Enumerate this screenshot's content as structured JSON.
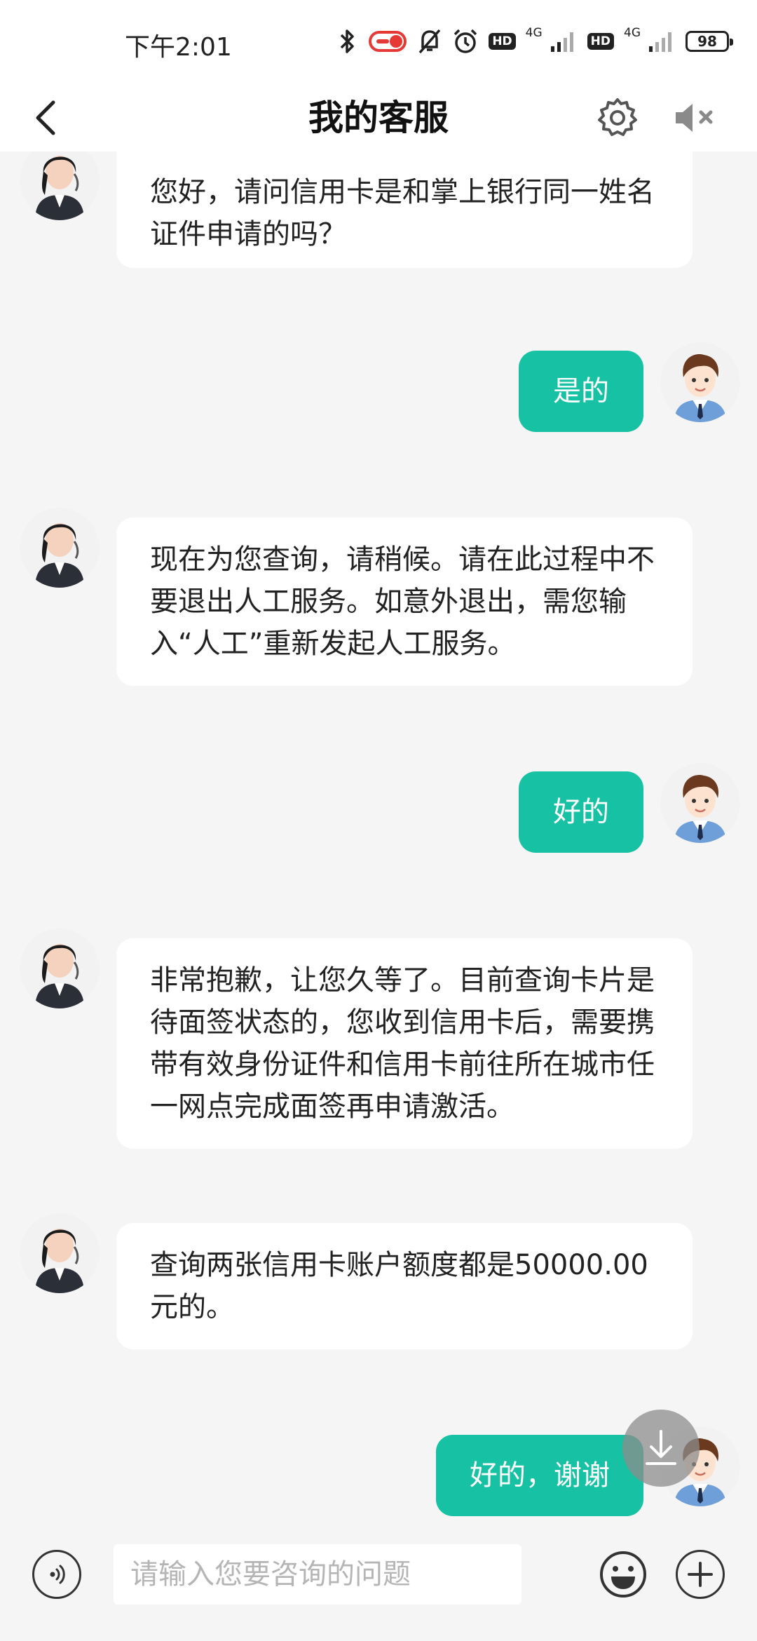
{
  "status_bar": {
    "time": "下午2:01",
    "hd1": "HD",
    "net1": "4G",
    "hd2": "HD",
    "net2": "4G",
    "battery": "98",
    "icons": [
      "bluetooth-icon",
      "recording-pill-icon",
      "bell-muted-icon",
      "alarm-icon",
      "signal-icon",
      "battery-icon"
    ]
  },
  "header": {
    "title": "我的客服",
    "back_icon": "chevron-left-icon",
    "settings_icon": "gear-icon",
    "mute_icon": "speaker-muted-icon"
  },
  "colors": {
    "accent": "#16c2a3",
    "background": "#f5f5f5",
    "agent_bubble": "#ffffff"
  },
  "messages": [
    {
      "from": "agent",
      "text": "您好，请问信用卡是和掌上银行同一姓名证件申请的吗？"
    },
    {
      "from": "user",
      "text": "是的"
    },
    {
      "from": "agent",
      "text": "现在为您查询，请稍候。请在此过程中不要退出人工服务。如意外退出，需您输入“人工”重新发起人工服务。"
    },
    {
      "from": "user",
      "text": "好的"
    },
    {
      "from": "agent",
      "text": "非常抱歉，让您久等了。目前查询卡片是待面签状态的，您收到信用卡后，需要携带有效身份证件和信用卡前往所在城市任一网点完成面签再申请激活。"
    },
    {
      "from": "agent",
      "text": "查询两张信用卡账户额度都是50000.00元的。"
    },
    {
      "from": "user",
      "text": "好的，谢谢"
    }
  ],
  "input_bar": {
    "placeholder": "请输入您要咨询的问题",
    "voice_icon": "voice-icon",
    "emoji_icon": "emoji-icon",
    "plus_icon": "plus-icon"
  },
  "scroll_button_icon": "download-arrow-icon"
}
